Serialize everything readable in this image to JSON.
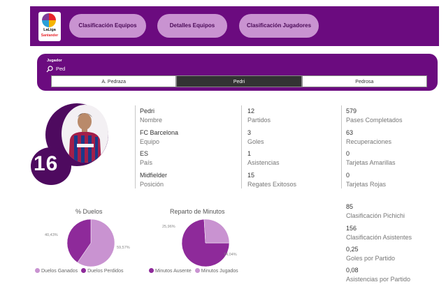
{
  "header": {
    "logo_text": "LaLiga",
    "logo_sub": "Santander",
    "nav": [
      "Clasificación Equipos",
      "Detalles Equipos",
      "Clasificación Jugadores"
    ],
    "colors": {
      "primary": "#6b0b7f",
      "button": "#c993d1",
      "dark": "#4e0a5f"
    }
  },
  "slicer": {
    "label": "Jugador",
    "search_value": "Ped",
    "options": [
      "A. Pedraza",
      "Pedri",
      "Pedrosa"
    ],
    "selected": "Pedri"
  },
  "player": {
    "number": "16",
    "fields": [
      {
        "value": "Pedri",
        "label": "Nombre"
      },
      {
        "value": "FC Barcelona",
        "label": "Equipo"
      },
      {
        "value": "ES",
        "label": "País"
      },
      {
        "value": "Midfielder",
        "label": "Posición"
      }
    ],
    "stats_mid": [
      {
        "value": "12",
        "label": "Partidos"
      },
      {
        "value": "3",
        "label": "Goles"
      },
      {
        "value": "1",
        "label": "Asistencias"
      },
      {
        "value": "15",
        "label": "Regates Exitosos"
      }
    ],
    "stats_right": [
      {
        "value": "579",
        "label": "Pases Completados"
      },
      {
        "value": "63",
        "label": "Recuperaciones"
      },
      {
        "value": "0",
        "label": "Tarjetas Amarillas"
      },
      {
        "value": "0",
        "label": "Tarjetas Rojas"
      }
    ],
    "stats_bottom": [
      {
        "value": "85",
        "label": "Clasificación Pichichi"
      },
      {
        "value": "156",
        "label": "Clasificación Asistentes"
      },
      {
        "value": "0,25",
        "label": "Goles por Partido"
      },
      {
        "value": "0,08",
        "label": "Asistencias por Partido"
      }
    ]
  },
  "chart_data": [
    {
      "type": "pie",
      "title": "% Duelos",
      "categories": [
        "Duelos Ganados",
        "Duelos Perdidos"
      ],
      "values": [
        59.57,
        40.43
      ],
      "labels": [
        "59,57%",
        "40,43%"
      ],
      "colors": [
        "#c993d1",
        "#8e2a9a"
      ]
    },
    {
      "type": "pie",
      "title": "Reparto de Minutos",
      "categories": [
        "Minutos Ausente",
        "Minutos Jugados"
      ],
      "values": [
        74.04,
        25.96
      ],
      "labels": [
        "74,04%",
        "25,96%"
      ],
      "colors": [
        "#8e2a9a",
        "#c993d1"
      ]
    }
  ]
}
